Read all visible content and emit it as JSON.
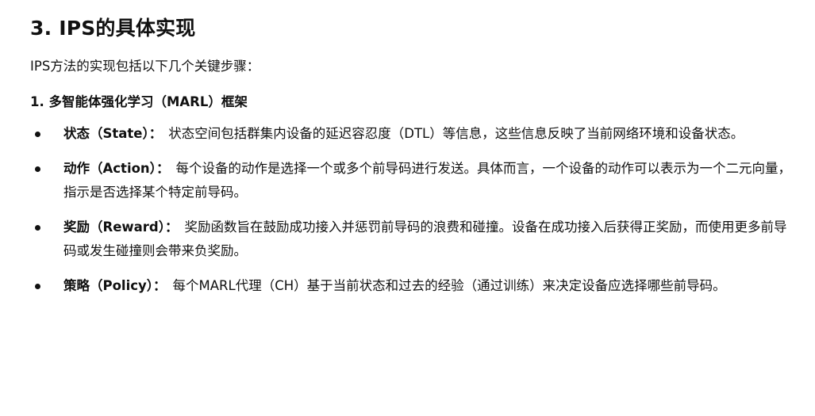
{
  "doc": {
    "title": "3. IPS的具体实现",
    "intro": "IPS方法的实现包括以下几个关键步骤：",
    "subheading": "1. 多智能体强化学习（MARL）框架",
    "items": [
      {
        "term": "状态（State）",
        "colon": "：",
        "text": "状态空间包括群集内设备的延迟容忍度（DTL）等信息，这些信息反映了当前网络环境和设备状态。"
      },
      {
        "term": "动作（Action）",
        "colon": "：",
        "text": "每个设备的动作是选择一个或多个前导码进行发送。具体而言，一个设备的动作可以表示为一个二元向量，指示是否选择某个特定前导码。"
      },
      {
        "term": "奖励（Reward）",
        "colon": "：",
        "text": "奖励函数旨在鼓励成功接入并惩罚前导码的浪费和碰撞。设备在成功接入后获得正奖励，而使用更多前导码或发生碰撞则会带来负奖励。"
      },
      {
        "term": "策略（Policy）",
        "colon": "：",
        "text": "每个MARL代理（CH）基于当前状态和过去的经验（通过训练）来决定设备应选择哪些前导码。"
      }
    ]
  }
}
